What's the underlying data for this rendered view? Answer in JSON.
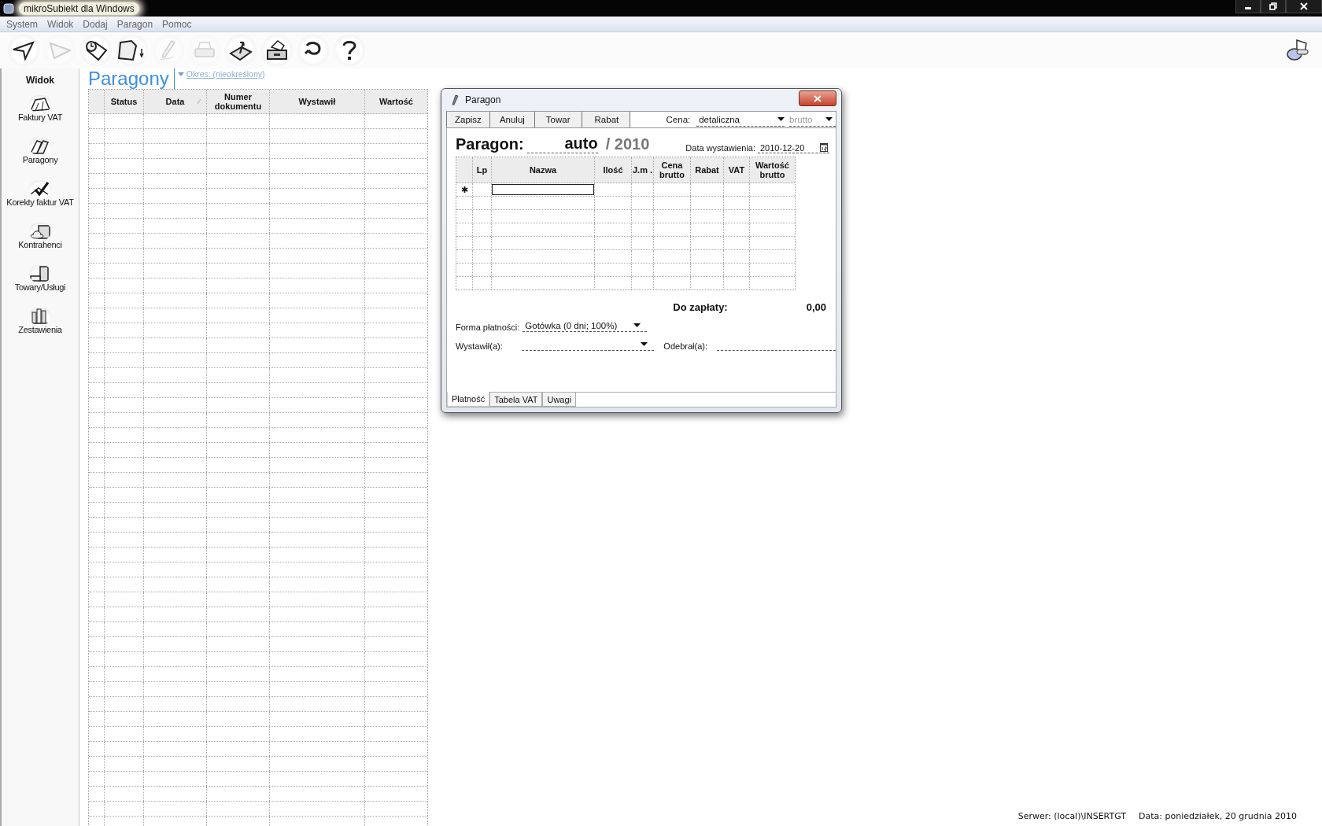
{
  "window": {
    "title": "mikroSubiekt dla Windows"
  },
  "menu": [
    "System",
    "Widok",
    "Dodaj",
    "Paragon",
    "Pomoc"
  ],
  "toolbar": [
    {
      "kind": "back",
      "disabled": false
    },
    {
      "kind": "forward",
      "disabled": true
    },
    {
      "kind": "clipboard",
      "disabled": false
    },
    {
      "kind": "new-document",
      "disabled": false
    },
    {
      "kind": "edit",
      "disabled": true
    },
    {
      "kind": "print",
      "disabled": true
    },
    {
      "kind": "export",
      "disabled": false
    },
    {
      "kind": "drawer",
      "disabled": false
    },
    {
      "kind": "refresh",
      "disabled": false
    },
    {
      "kind": "help",
      "disabled": false
    }
  ],
  "sidebar": {
    "title": "Widok",
    "items": [
      {
        "kind": "invoices",
        "label": "Faktury VAT"
      },
      {
        "kind": "receipts",
        "label": "Paragony"
      },
      {
        "kind": "corrections",
        "label": "Korekty faktur VAT"
      },
      {
        "kind": "contractors",
        "label": "Kontrahenci"
      },
      {
        "kind": "goods",
        "label": "Towary/Usługi"
      },
      {
        "kind": "reports",
        "label": "Zestawienia"
      }
    ]
  },
  "list": {
    "title": "Paragony",
    "period": "Okres: (nieokreślony)",
    "columns": [
      {
        "label": "Status",
        "sorted": false
      },
      {
        "label": "Data",
        "sorted": true
      },
      {
        "label": "Numer dokumentu",
        "sorted": false
      },
      {
        "label": "Wystawił",
        "sorted": false
      },
      {
        "label": "Wartość",
        "sorted": false
      }
    ]
  },
  "dialog": {
    "title": "Paragon",
    "buttons": [
      "Zapisz",
      "Anuluj",
      "Towar",
      "Rabat"
    ],
    "price_label": "Cena:",
    "price_type": "detaliczna",
    "price_mode": "brutto",
    "doc_label": "Paragon:",
    "doc_number": "auto",
    "doc_year": "/ 2010",
    "date_label": "Data wystawienia:",
    "date_value": "2010-12-20",
    "columns": [
      "Lp",
      "Nazwa",
      "Ilość",
      "J.m .",
      "Cena brutto",
      "Rabat",
      "VAT",
      "Wartość brutto"
    ],
    "new_row_marker": "✱",
    "total_label": "Do zapłaty:",
    "total_value": "0,00",
    "payment_label": "Forma płatności:",
    "payment_value": "Gotówka (0 dni; 100%)",
    "issuer_label": "Wystawił(a):",
    "receiver_label": "Odebrał(a):",
    "tabs": [
      {
        "label": "Płatność",
        "selected": true
      },
      {
        "label": "Tabela VAT",
        "selected": false
      },
      {
        "label": "Uwagi",
        "selected": false
      }
    ]
  },
  "status_bar": [
    "Serwer: (local)\\INSERTGT",
    "Data: poniedziałek, 20 grudnia 2010"
  ]
}
